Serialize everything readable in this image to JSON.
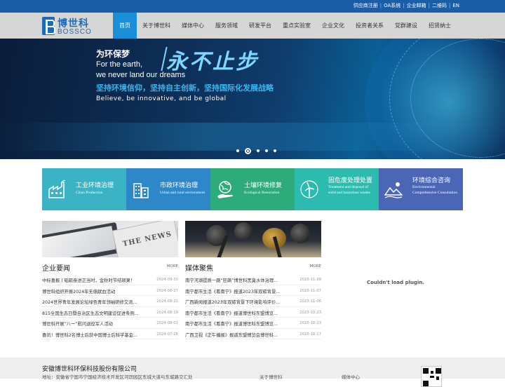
{
  "topbar": {
    "links": [
      "供应商注册",
      "OA系统",
      "企业邮箱",
      "二维码",
      "EN"
    ]
  },
  "logo": {
    "cn": "博世科",
    "en": "BOSSCO"
  },
  "nav": {
    "items": [
      "首页",
      "关于博世科",
      "媒体中心",
      "服务领域",
      "研发平台",
      "重点实验室",
      "企业文化",
      "投资者关系",
      "党群建设",
      "招贤纳士"
    ],
    "active_index": 0
  },
  "banner": {
    "line1": "为环保梦",
    "line2": "For the earth,",
    "line3": "we never land our dreams",
    "headline": "永不止步",
    "slogan": "坚持环境信仰，坚持自主创新，坚持国际化发展战略",
    "slogan_en": "Believe, be innovative, and be global",
    "slides": 5,
    "active_slide": 1
  },
  "tiles": [
    {
      "name": "工业环境治理",
      "sub1": "Clean Production",
      "sub2": "",
      "color": "#3bb3c4",
      "icon": "factory-icon"
    },
    {
      "name": "市政环境治理",
      "sub1": "Urban and rural environment",
      "sub2": "",
      "color": "#2d87c8",
      "icon": "buildings-icon"
    },
    {
      "name": "土壤环境修复",
      "sub1": "Ecological Restoration",
      "sub2": "",
      "color": "#2dab7b",
      "icon": "earth-hand-icon"
    },
    {
      "name": "固危废处理处置",
      "sub1": "Treatment and disposal of",
      "sub2": "solid and hazardous wastes",
      "color": "#2dbbb0",
      "icon": "wind-turbine-icon"
    },
    {
      "name": "环境综合咨询",
      "sub1": "Environmental",
      "sub2": "Comprehensive Consultation",
      "color": "#4a66b4",
      "icon": "landscape-icon"
    }
  ],
  "news": {
    "title": "企业要闻",
    "more": "MORE",
    "items": [
      {
        "text": "中标喜报丨砥砺奋进正当时，金秋时节结硕果！",
        "date": "2024-09-30"
      },
      {
        "text": "博世科组织开展2024年无偿献血活动",
        "date": "2024-08-27"
      },
      {
        "text": "2024世界青年发展论坛绿色青年领袖研修交流...",
        "date": "2024-08-21"
      },
      {
        "text": "815全国生态日暨自治区生态文明建设促进条例...",
        "date": "2024-08-19"
      },
      {
        "text": "博世科开展“八一”慰问退役军人活动",
        "date": "2024-08-02"
      },
      {
        "text": "喜讯！博世科2名博士后获中国博士后科学基金...",
        "date": "2024-07-26"
      }
    ]
  },
  "media": {
    "title": "媒体聚焦",
    "more": "MORE",
    "items": [
      {
        "text": "南宁河湖提质一路“狂飙”博世科黑臭水体治理...",
        "date": "2023-11-29"
      },
      {
        "text": "南宁都市生活《看南宁》报道2023年双碳背景...",
        "date": "2023-11-07"
      },
      {
        "text": "广西新闻报道2023年双碳背景下环境影响评价...",
        "date": "2023-11-06"
      },
      {
        "text": "南宁都市生活《看南宁》报道博世科东盟博览...",
        "date": "2023-10-23"
      },
      {
        "text": "南宁都市生活《看南宁》报道博世科东盟博览...",
        "date": "2023-10-23"
      },
      {
        "text": "广西卫视《正午播报》报道东盟博览会博世科...",
        "date": "2023-10-17"
      }
    ],
    "image_caption": "THE NEWS"
  },
  "plugin": {
    "message": "Couldn't load plugin."
  },
  "footer": {
    "company": "安徽博世科环保科技股份有限公司",
    "address": "地址：安徽省宁国市宁国经济技术开发区河沥园区东城大道与东城路交汇处",
    "link1": "关于博世科",
    "link2": "媒体中心"
  }
}
